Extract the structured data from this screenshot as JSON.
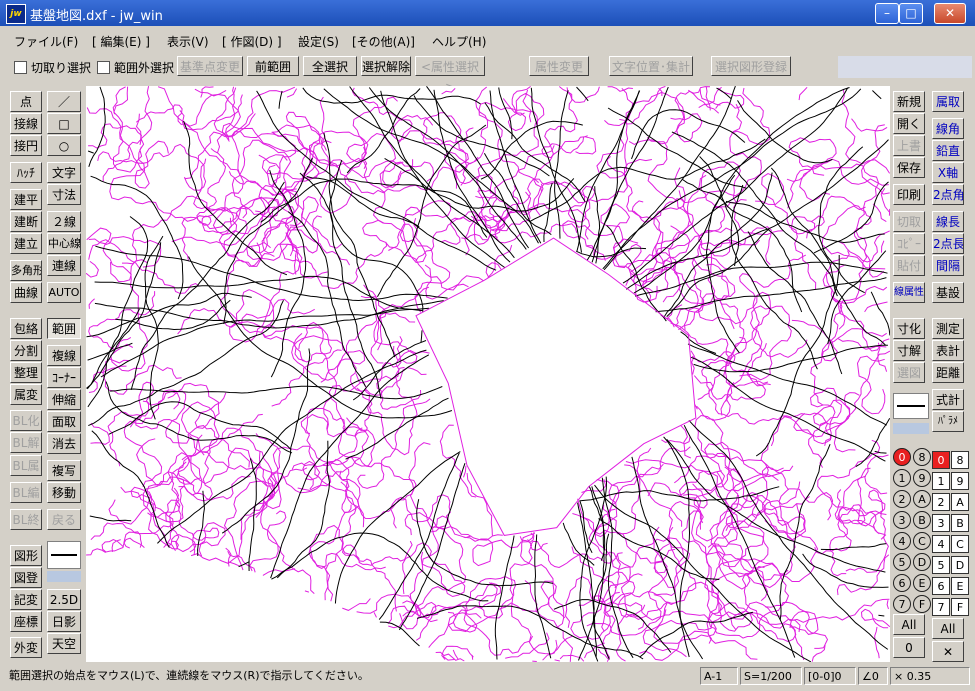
{
  "window": {
    "title": "基盤地図.dxf - jw_win",
    "icon_label": "jw",
    "minimize": "–",
    "maximize": "□",
    "close": "✕"
  },
  "menu": [
    "ファイル(F)",
    "[ 編集(E) ]",
    "表示(V)",
    "[ 作図(D) ]",
    "設定(S)",
    "[その他(A)]",
    "ヘルプ(H)"
  ],
  "toolbar": {
    "checkbox1": "切取り選択",
    "checkbox2": "範囲外選択",
    "buttons": [
      "基準点変更",
      "前範囲",
      "全選択",
      "選択解除",
      "<属性選択>",
      "属性変更",
      "文字位置･集計",
      "選択図形登録"
    ]
  },
  "left_col1": [
    "点",
    "接線",
    "接円",
    "ﾊｯﾁ",
    "建平",
    "建断",
    "建立",
    "多角形",
    "曲線",
    "包絡",
    "分割",
    "整理",
    "属変",
    "BL化",
    "BL解",
    "BL属",
    "BL編",
    "BL終",
    "図形",
    "図登",
    "記変",
    "座標",
    "外変"
  ],
  "left_col2": [
    "／",
    "□",
    "○",
    "文字",
    "寸法",
    "２線",
    "中心線",
    "連線",
    "AUTO",
    "範囲",
    "複線",
    "ｺｰﾅｰ",
    "伸縮",
    "面取",
    "消去",
    "複写",
    "移動",
    "戻る",
    "2.5D",
    "日影",
    "天空"
  ],
  "right_col1": [
    "新規",
    "開く",
    "上書",
    "保存",
    "印刷",
    "切取",
    "ｺﾋﾟｰ",
    "貼付",
    "線属性",
    "寸化",
    "寸解",
    "選図"
  ],
  "right_col2": [
    "属取",
    "線角",
    "鉛直",
    "X軸",
    "2点角",
    "線長",
    "2点長",
    "間隔",
    "基設",
    "測定",
    "表計",
    "距離",
    "式計",
    "ﾊﾟﾗﾒ"
  ],
  "layers_circle": [
    "0",
    "8",
    "1",
    "9",
    "2",
    "A",
    "3",
    "B",
    "4",
    "C",
    "5",
    "D",
    "6",
    "E",
    "7",
    "F"
  ],
  "layers_square": [
    "0",
    "8",
    "1",
    "9",
    "2",
    "A",
    "3",
    "B",
    "4",
    "C",
    "5",
    "D",
    "6",
    "E",
    "7",
    "F"
  ],
  "layer_all_1": "All",
  "layer_zero": "0",
  "layer_all_2": "All",
  "layer_close": "✕",
  "status": {
    "message": "範囲選択の始点をマウス(L)で、連続線をマウス(R)で指示してください。",
    "paper": "A-1",
    "scale": "S=1/200",
    "layer": "[0-0]0",
    "angle": "∠0",
    "zoom": "× 0.35"
  },
  "colors": {
    "map_boundary": "#e020e0",
    "map_road": "#000000",
    "canvas": "#ffffff",
    "selected_layer": "#e82020"
  }
}
